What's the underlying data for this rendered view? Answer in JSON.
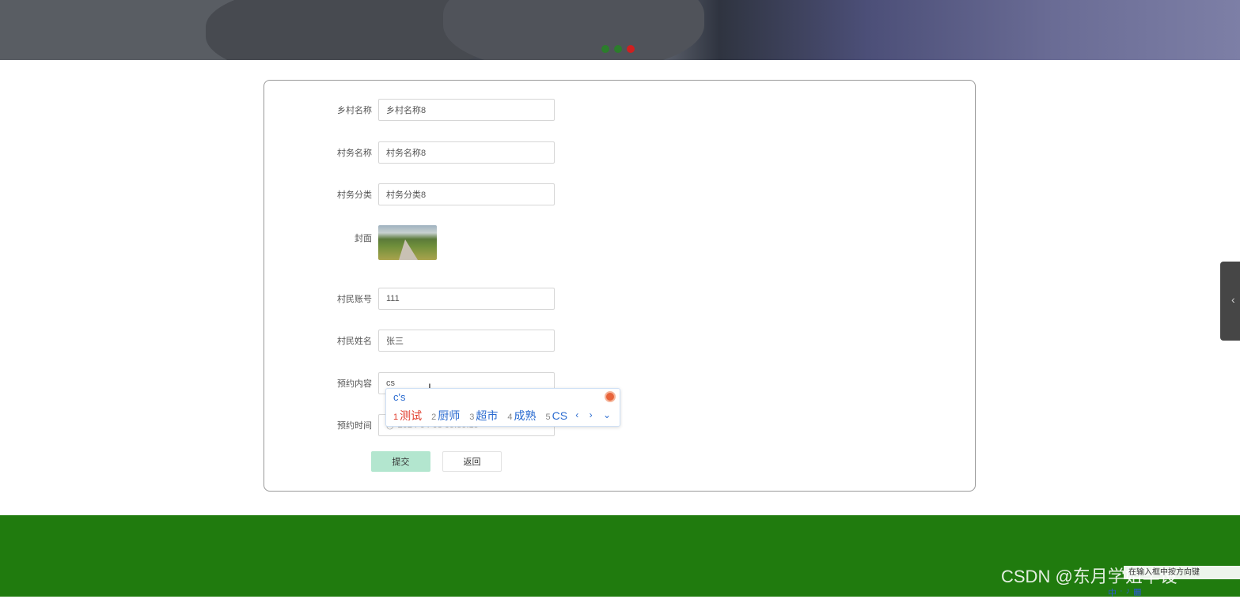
{
  "banner": {
    "slides": [
      {
        "active": false
      },
      {
        "active": false
      },
      {
        "active": true
      }
    ]
  },
  "form": {
    "fields": [
      {
        "label": "乡村名称",
        "value": "乡村名称8"
      },
      {
        "label": "村务名称",
        "value": "村务名称8"
      },
      {
        "label": "村务分类",
        "value": "村务分类8"
      }
    ],
    "cover_label": "封面",
    "fields2": [
      {
        "label": "村民账号",
        "value": "111"
      },
      {
        "label": "村民姓名",
        "value": "张三"
      },
      {
        "label": "预约内容",
        "value": "cs"
      },
      {
        "label": "预约时间",
        "value": "2024-04-08 09:59:19"
      }
    ],
    "submit_label": "提交",
    "back_label": "返回"
  },
  "ime": {
    "composition": "c's",
    "candidates": [
      {
        "n": "1",
        "text": "测试"
      },
      {
        "n": "2",
        "text": "厨师"
      },
      {
        "n": "3",
        "text": "超市"
      },
      {
        "n": "4",
        "text": "成熟"
      },
      {
        "n": "5",
        "text": "CS"
      }
    ],
    "nav": "‹ › ⌄"
  },
  "side_tab": {
    "icon": "chevron-left-icon",
    "glyph": "‹"
  },
  "footer": {
    "watermark": "CSDN @东月学姐毕设",
    "hint": "在输入框中按方向键"
  },
  "colors": {
    "footer": "#207b0e",
    "submit": "#b3e6cf",
    "ime_accent": "#2a6bd0",
    "ime_first": "#e03a2a"
  }
}
